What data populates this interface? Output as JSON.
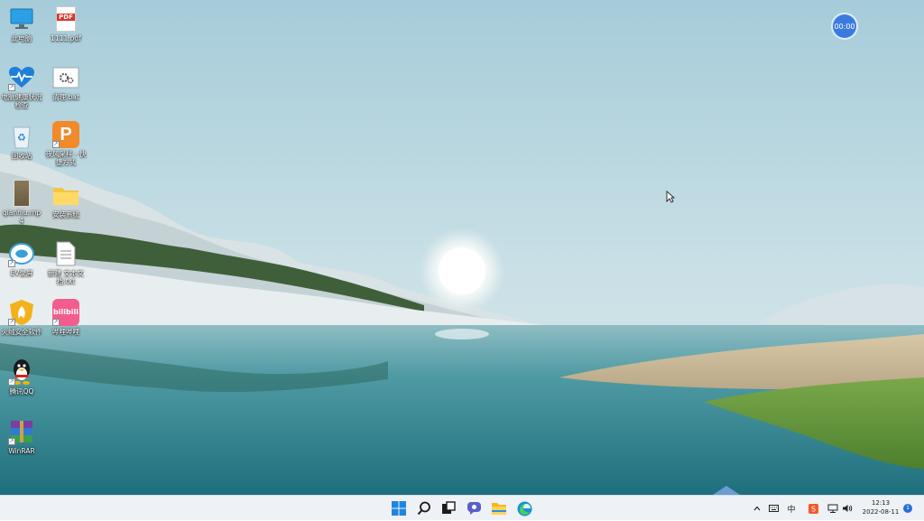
{
  "desktop": {
    "icons": [
      {
        "label": "此电脑",
        "icon": "monitor-icon"
      },
      {
        "label": "1111.pdf",
        "icon": "pdf-icon",
        "badge": "PDF"
      },
      {
        "label": "电脑健康状况检查",
        "icon": "health-heart-icon"
      },
      {
        "label": "清理.bat",
        "icon": "batch-gear-icon"
      },
      {
        "label": "回收站",
        "icon": "recycle-bin-icon"
      },
      {
        "label": "夜风采样 - 快捷方式",
        "icon": "powerpoint-icon",
        "badge": "P"
      },
      {
        "label": "qianhiu.mp4",
        "icon": "video-icon"
      },
      {
        "label": "安装系统",
        "icon": "folder-icon"
      },
      {
        "label": "EV录屏",
        "icon": "ev-recorder-icon"
      },
      {
        "label": "新建 文本文档.txt",
        "icon": "text-file-icon"
      },
      {
        "label": "火绒安全软件",
        "icon": "huorong-icon"
      },
      {
        "label": "哔哩哔哩",
        "icon": "bilibili-icon",
        "badge": "bilibili"
      },
      {
        "label": "腾讯QQ",
        "icon": "qq-penguin-icon"
      },
      {
        "label": "WinRAR",
        "icon": "winrar-icon"
      }
    ]
  },
  "timer": {
    "value": "00:00"
  },
  "taskbar": {
    "apps": [
      {
        "name": "start-button",
        "icon": "windows-logo-icon"
      },
      {
        "name": "search-button",
        "icon": "search-icon"
      },
      {
        "name": "task-view-button",
        "icon": "task-view-icon"
      },
      {
        "name": "chat-button",
        "icon": "chat-icon"
      },
      {
        "name": "file-explorer-button",
        "icon": "folder-icon"
      },
      {
        "name": "edge-button",
        "icon": "edge-icon"
      }
    ],
    "tray": {
      "time": "12:13",
      "date": "2022-08-11",
      "ime": "中",
      "notification_count": "1"
    }
  },
  "colors": {
    "taskbar_bg": "#eef1f5",
    "accent": "#2a6fd6",
    "sky_top": "#a9cfdc",
    "water": "#3f8f98"
  }
}
